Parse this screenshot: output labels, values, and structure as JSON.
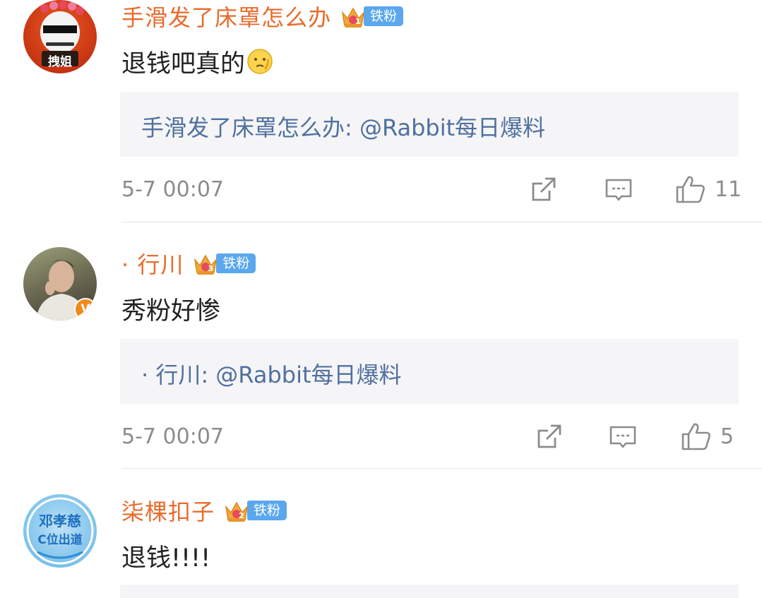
{
  "comments": [
    {
      "username": "手滑发了床罩怎么办",
      "badge_level": "1",
      "badge_label": "铁粉",
      "avatar_text": "拽姐",
      "text": "退钱吧真的",
      "quote": "手滑发了床罩怎么办: @Rabbit每日爆料",
      "time": "5-7 00:07",
      "likes": "11"
    },
    {
      "username": "· 行川",
      "badge_level": "3",
      "badge_label": "铁粉",
      "avatar_verified": "V",
      "text": "秀粉好惨",
      "quote": "· 行川: @Rabbit每日爆料",
      "time": "5-7 00:07",
      "likes": "5"
    },
    {
      "username": "柒棵扣子",
      "badge_level": "2",
      "badge_label": "铁粉",
      "avatar_text_1": "邓孝慈",
      "avatar_text_2": "C位出道",
      "text": "退钱!!!!"
    }
  ],
  "colors": {
    "username": "#e86b2c",
    "quote_link": "#50709e",
    "meta_gray": "#8c8c8c",
    "badge_blue": "#5aa7ee",
    "crown_gold": "#f0a93b"
  },
  "icons": [
    "share-icon",
    "comment-icon",
    "like-icon",
    "verified-icon",
    "crown-icon",
    "emoji-icon"
  ]
}
